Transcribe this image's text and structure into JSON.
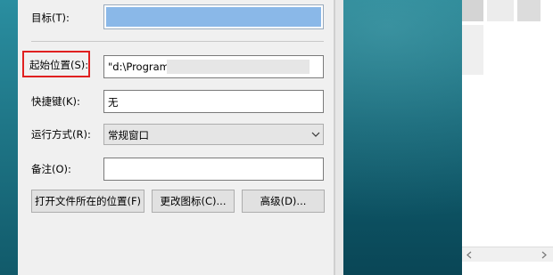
{
  "dialog": {
    "target_label": "目标(T):",
    "start_in_label": "起始位置(S):",
    "start_in_value": "\"d:\\Program",
    "shortcut_key_label": "快捷键(K):",
    "shortcut_key_value": "无",
    "run_label": "运行方式(R):",
    "run_value": "常规窗口",
    "comment_label": "备注(O):",
    "comment_value": "",
    "open_location_button": "打开文件所在的位置(F)",
    "change_icon_button": "更改图标(C)...",
    "advanced_button": "高级(D)..."
  },
  "colors": {
    "highlight": "#e02020",
    "selection_blue": "#8ab8e8",
    "desktop_teal": "#0f5f70"
  },
  "icons": {
    "dropdown": "chevron-down-icon",
    "scroll_left": "chevron-left-icon",
    "scroll_right": "chevron-right-icon"
  }
}
